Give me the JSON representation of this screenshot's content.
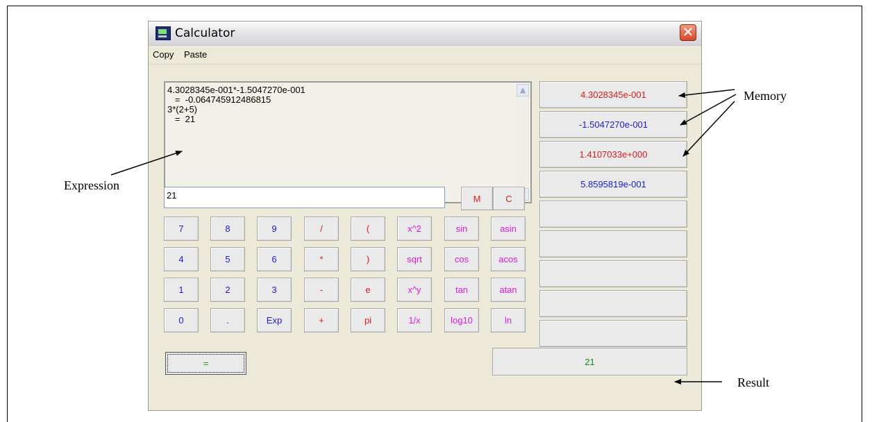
{
  "window": {
    "title": "Calculator",
    "close_glyph": "✕"
  },
  "menu": {
    "copy": "Copy",
    "paste": "Paste"
  },
  "expression": {
    "lines": [
      "4.3028345e-001*-1.5047270e-001",
      "   =  -0.064745912486815",
      "3*(2+5)",
      "   =  21"
    ],
    "scroll_up_glyph": "▲",
    "scroll_down_glyph": "▼"
  },
  "entry": {
    "value": "21"
  },
  "mem_buttons": {
    "m": "M",
    "c": "C"
  },
  "keypad": {
    "row1": [
      "7",
      "8",
      "9",
      "/",
      "(",
      "x^2",
      "sin",
      "asin"
    ],
    "row2": [
      "4",
      "5",
      "6",
      "*",
      ")",
      "sqrt",
      "cos",
      "acos"
    ],
    "row3": [
      "1",
      "2",
      "3",
      "-",
      "e",
      "x^y",
      "tan",
      "atan"
    ],
    "row4": [
      "0",
      ".",
      "Exp",
      "+",
      "pi",
      "1/x",
      "log10",
      "ln"
    ]
  },
  "memory": {
    "slots": [
      "4.3028345e-001",
      "-1.5047270e-001",
      "1.4107033e+000",
      "5.8595819e-001",
      "",
      "",
      "",
      "",
      ""
    ],
    "colors": [
      "#e01a1a",
      "#1a1ae0",
      "#e01a1a",
      "#1a1ae0"
    ]
  },
  "equals": "=",
  "result": "21",
  "annotations": {
    "memory": "Memory",
    "expression": "Expression",
    "result": "Result"
  }
}
